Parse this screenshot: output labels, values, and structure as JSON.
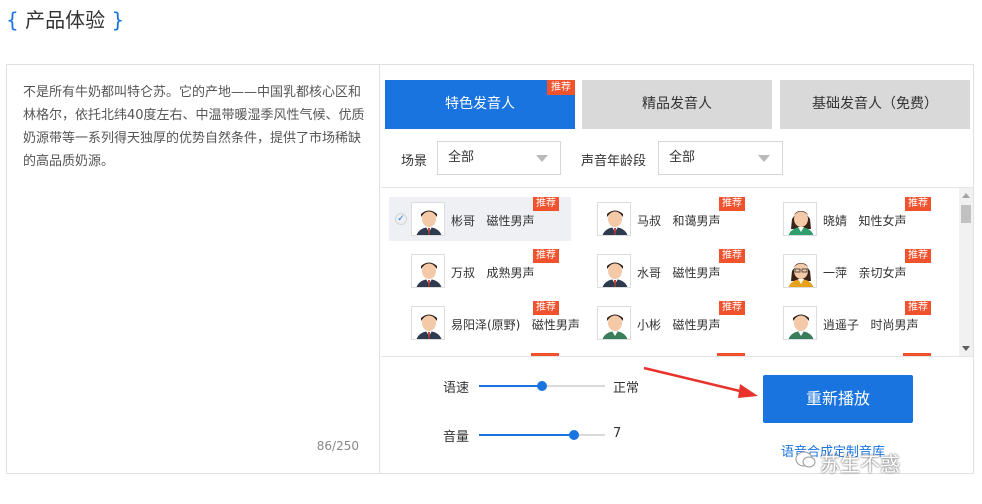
{
  "header": {
    "brace_open": "{",
    "title": "产品体验",
    "brace_close": "}"
  },
  "text_panel": {
    "content": "不是所有牛奶都叫特仑苏。它的产地——中国乳都核心区和林格尔，依托北纬40度左右、中温带暖湿季风性气候、优质奶源带等一系列得天独厚的优势自然条件，提供了市场稀缺的高品质奶源。",
    "counter": "86/250"
  },
  "tabs": [
    {
      "label": "特色发音人",
      "tag": "推荐",
      "active": true
    },
    {
      "label": "精品发音人",
      "tag": "",
      "active": false
    },
    {
      "label": "基础发音人（免费）",
      "tag": "",
      "active": false
    }
  ],
  "filters": {
    "scene_label": "场景",
    "scene_value": "全部",
    "age_label": "声音年龄段",
    "age_value": "全部"
  },
  "voices": [
    {
      "name": "彬哥",
      "desc": "磁性男声",
      "tag": "推荐",
      "gender": "male",
      "selected": true
    },
    {
      "name": "马叔",
      "desc": "和蔼男声",
      "tag": "推荐",
      "gender": "male",
      "selected": false
    },
    {
      "name": "晓婧",
      "desc": "知性女声",
      "tag": "推荐",
      "gender": "female",
      "selected": false
    },
    {
      "name": "万叔",
      "desc": "成熟男声",
      "tag": "推荐",
      "gender": "male",
      "selected": false
    },
    {
      "name": "水哥",
      "desc": "磁性男声",
      "tag": "推荐",
      "gender": "male",
      "selected": false
    },
    {
      "name": "一萍",
      "desc": "亲切女声",
      "tag": "推荐",
      "gender": "female2",
      "selected": false
    },
    {
      "name": "易阳泽(原野)",
      "desc": "磁性男声",
      "tag": "推荐",
      "gender": "male",
      "selected": false
    },
    {
      "name": "小彬",
      "desc": "磁性男声",
      "tag": "推荐",
      "gender": "boy",
      "selected": false
    },
    {
      "name": "逍遥子",
      "desc": "时尚男声",
      "tag": "推荐",
      "gender": "boy",
      "selected": false
    }
  ],
  "controls": {
    "speed_label": "语速",
    "speed_value_label": "正常",
    "speed_level": 0.5,
    "volume_label": "音量",
    "volume_value_label": "7",
    "volume_level": 0.75
  },
  "replay_label": "重新播放",
  "custom_link": "语音合成定制音库",
  "watermark": "苏生不惑",
  "colors": {
    "accent": "#1a74e0",
    "tag": "#f0522e",
    "arrow": "#e8322c"
  }
}
